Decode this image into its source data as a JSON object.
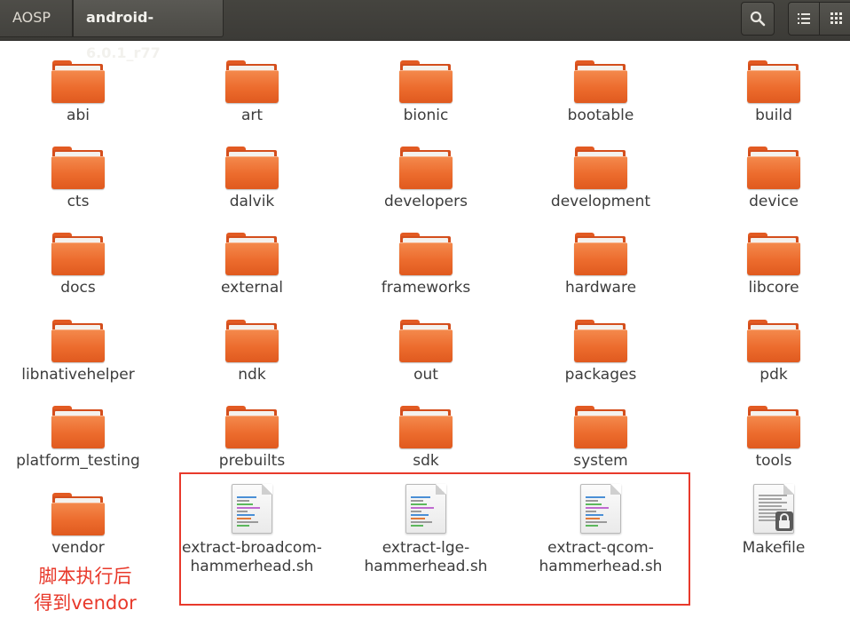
{
  "header": {
    "breadcrumbs": [
      "AOSP",
      "android-6.0.1_r77"
    ],
    "buttons": [
      "search-icon",
      "list-view-icon",
      "grid-view-icon"
    ]
  },
  "folders": [
    "abi",
    "art",
    "bionic",
    "bootable",
    "build",
    "cts",
    "dalvik",
    "developers",
    "development",
    "device",
    "docs",
    "external",
    "frameworks",
    "hardware",
    "libcore",
    "libnativehelper",
    "ndk",
    "out",
    "packages",
    "pdk",
    "platform_testing",
    "prebuilts",
    "sdk",
    "system",
    "tools",
    "vendor"
  ],
  "files": [
    {
      "name_line1": "extract-broadcom-",
      "name_line2": "hammerhead.sh",
      "icon": "shell-script-icon"
    },
    {
      "name_line1": "extract-lge-",
      "name_line2": "hammerhead.sh",
      "icon": "shell-script-icon"
    },
    {
      "name_line1": "extract-qcom-",
      "name_line2": "hammerhead.sh",
      "icon": "shell-script-icon"
    },
    {
      "name_line1": "Makefile",
      "name_line2": "",
      "icon": "locked-text-file-icon"
    }
  ],
  "annotation": {
    "line1": "脚本执行后",
    "line2": "得到vendor",
    "color": "#e8392b"
  },
  "colors": {
    "folder_orange": "#ec6b2d",
    "header_bg": "#3c3b37"
  }
}
